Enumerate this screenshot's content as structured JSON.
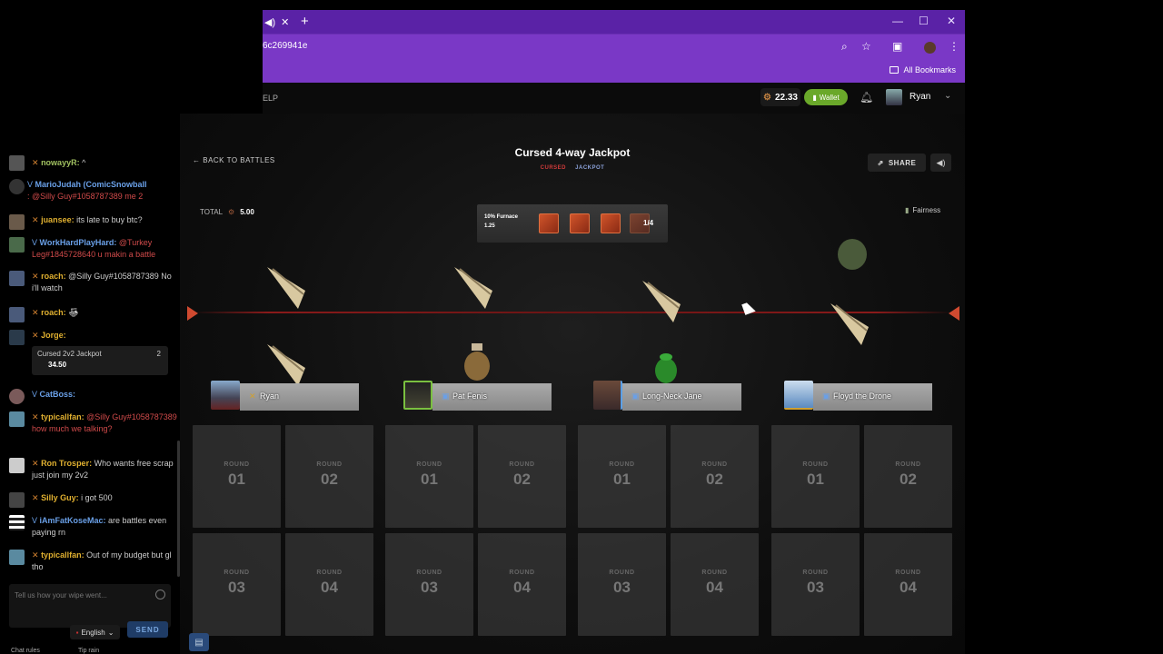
{
  "browser": {
    "url": "6c269941e",
    "bookmarks_label": "All Bookmarks",
    "tab_icon": "speaker-icon",
    "close_tab": "✕",
    "new_tab": "+"
  },
  "site_header": {
    "help": "ELP",
    "balance": "22.33",
    "wallet_label": "Wallet",
    "username": "Ryan"
  },
  "chat": {
    "messages": [
      {
        "user": "nowayyR:",
        "text": " ^",
        "color": "#a0c060"
      },
      {
        "user": "MarioJudah (ComicSnowball",
        "text": ": @Silly Guy#1058787389 me 2",
        "color": "#6aa0e8"
      },
      {
        "user": "juansee:",
        "text": " its late to buy btc?",
        "color": "#e0b030"
      },
      {
        "user": "WorkHardPlayHard:",
        "text": " @Turkey Leg#1845728640 u makin a battle",
        "color": "#6aa0e8"
      },
      {
        "user": "roach:",
        "text": " @Silly Guy#1058787389 No i'll watch",
        "color": "#e0b030"
      },
      {
        "user": "roach:",
        "text": "",
        "color": "#e0b030"
      },
      {
        "user": "Jorge:",
        "text": "",
        "color": "#e0b030"
      },
      {
        "user": "CatBoss:",
        "text": "",
        "color": "#6aa0e8"
      },
      {
        "user": "typicallfan:",
        "text": " @Silly Guy#1058787389 how much we talking?",
        "color": "#e0b030"
      },
      {
        "user": "Ron Trosper:",
        "text": " Who wants free scrap just join my 2v2",
        "color": "#e0b030"
      },
      {
        "user": "Silly Guy:",
        "text": " i got 500",
        "color": "#e0b030"
      },
      {
        "user": "iAmFatKoseMac:",
        "text": " are battles even paying rn",
        "color": "#6aa0e8"
      },
      {
        "user": "typicallfan:",
        "text": " Out of my budget but gl tho",
        "color": "#e0b030"
      }
    ],
    "shared_battle": {
      "name": "Cursed 2v2 Jackpot",
      "players": "2",
      "value": "34.50"
    },
    "input_placeholder": "Tell us how your wipe went...",
    "language": "English",
    "send": "SEND",
    "chat_rules": "Chat rules",
    "tip_rain": "Tip rain"
  },
  "game": {
    "back": "BACK TO BATTLES",
    "title": "Cursed 4-way Jackpot",
    "tag_cursed": "CURSED",
    "tag_jackpot": "JACKPOT",
    "share": "SHARE",
    "total_label": "TOTAL",
    "total_value": "5.00",
    "fairness": "Fairness",
    "furnace_label": "10% Furnace",
    "furnace_value": "1.25",
    "round_progress": "1/4",
    "players": [
      {
        "name": "Ryan",
        "color": "#d0a030"
      },
      {
        "name": "Pat Fenis",
        "color": "#6aa0e8"
      },
      {
        "name": "Long-Neck Jane",
        "color": "#6aa0e8"
      },
      {
        "name": "Floyd the Drone",
        "color": "#6aa0e8"
      }
    ],
    "round_label": "ROUND",
    "rounds": [
      "01",
      "02",
      "01",
      "02",
      "01",
      "02",
      "01",
      "02",
      "03",
      "04",
      "03",
      "04",
      "03",
      "04",
      "03",
      "04"
    ]
  }
}
